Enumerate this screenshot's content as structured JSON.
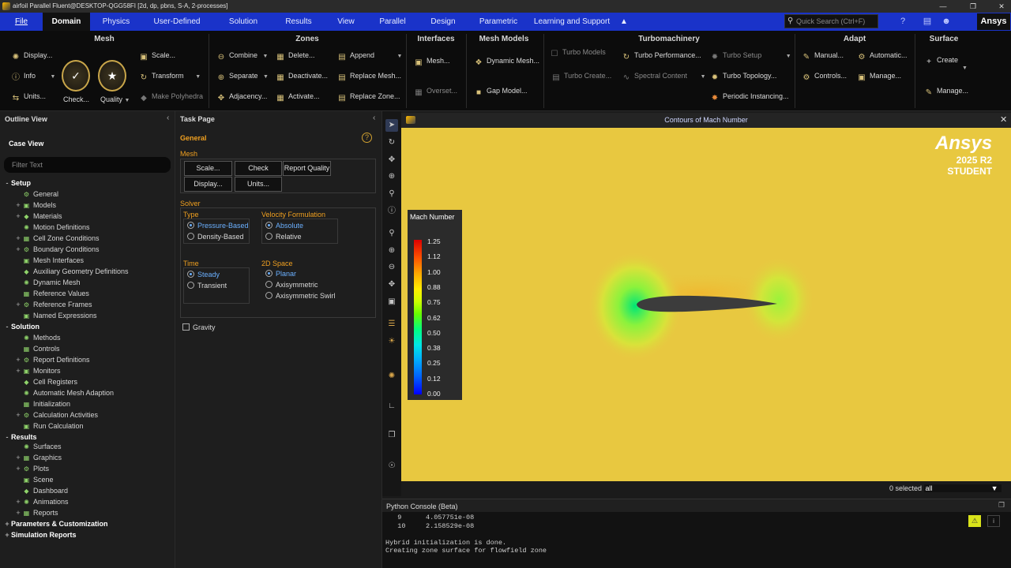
{
  "window": {
    "title": "airfoil Parallel Fluent@DESKTOP-QGG58FI  [2d, dp, pbns, S-A, 2-processes]"
  },
  "menu": {
    "items": [
      "File",
      "Domain",
      "Physics",
      "User-Defined",
      "Solution",
      "Results",
      "View",
      "Parallel",
      "Design",
      "Parametric",
      "Learning and Support"
    ],
    "active": "Domain",
    "search_placeholder": "Quick Search (Ctrl+F)",
    "brand": "Ansys"
  },
  "ribbon": {
    "mesh": {
      "title": "Mesh",
      "display": "Display...",
      "info": "Info",
      "units": "Units...",
      "check": "Check...",
      "quality": "Quality",
      "scale": "Scale...",
      "transform": "Transform",
      "make_polyhedra": "Make Polyhedra"
    },
    "zones": {
      "title": "Zones",
      "combine": "Combine",
      "separate": "Separate",
      "adjacency": "Adjacency...",
      "delete": "Delete...",
      "deactivate": "Deactivate...",
      "activate": "Activate...",
      "append": "Append",
      "replace_mesh": "Replace Mesh...",
      "replace_zone": "Replace Zone..."
    },
    "interfaces": {
      "title": "Interfaces",
      "mesh": "Mesh...",
      "overset": "Overset..."
    },
    "mesh_models": {
      "title": "Mesh Models",
      "dynamic_mesh": "Dynamic Mesh...",
      "gap_model": "Gap Model..."
    },
    "turbomachinery": {
      "title": "Turbomachinery",
      "turbo_models": "Turbo Models",
      "turbo_create": "Turbo Create...",
      "turbo_performance": "Turbo Performance...",
      "spectral_content": "Spectral Content",
      "turbo_setup": "Turbo Setup",
      "turbo_topology": "Turbo Topology...",
      "periodic_instancing": "Periodic Instancing..."
    },
    "adapt": {
      "title": "Adapt",
      "manual": "Manual...",
      "automatic": "Automatic...",
      "controls": "Controls...",
      "manage": "Manage..."
    },
    "surface": {
      "title": "Surface",
      "create": "Create",
      "manage": "Manage..."
    }
  },
  "outline": {
    "header": "Outline View",
    "case_view": "Case View",
    "filter_placeholder": "Filter Text",
    "tree": [
      {
        "label": "Setup",
        "level": 0,
        "section": true,
        "toggle": "-"
      },
      {
        "label": "General",
        "level": 1,
        "toggle": ""
      },
      {
        "label": "Models",
        "level": 1,
        "toggle": "+"
      },
      {
        "label": "Materials",
        "level": 1,
        "toggle": "+"
      },
      {
        "label": "Motion Definitions",
        "level": 1,
        "toggle": ""
      },
      {
        "label": "Cell Zone Conditions",
        "level": 1,
        "toggle": "+"
      },
      {
        "label": "Boundary Conditions",
        "level": 1,
        "toggle": "+"
      },
      {
        "label": "Mesh Interfaces",
        "level": 1,
        "toggle": ""
      },
      {
        "label": "Auxiliary Geometry Definitions",
        "level": 1,
        "toggle": ""
      },
      {
        "label": "Dynamic Mesh",
        "level": 1,
        "toggle": ""
      },
      {
        "label": "Reference Values",
        "level": 1,
        "toggle": ""
      },
      {
        "label": "Reference Frames",
        "level": 1,
        "toggle": "+"
      },
      {
        "label": "Named Expressions",
        "level": 1,
        "toggle": ""
      },
      {
        "label": "Solution",
        "level": 0,
        "section": true,
        "toggle": "-"
      },
      {
        "label": "Methods",
        "level": 1,
        "toggle": ""
      },
      {
        "label": "Controls",
        "level": 1,
        "toggle": ""
      },
      {
        "label": "Report Definitions",
        "level": 1,
        "toggle": "+"
      },
      {
        "label": "Monitors",
        "level": 1,
        "toggle": "+"
      },
      {
        "label": "Cell Registers",
        "level": 1,
        "toggle": ""
      },
      {
        "label": "Automatic Mesh Adaption",
        "level": 1,
        "toggle": ""
      },
      {
        "label": "Initialization",
        "level": 1,
        "toggle": ""
      },
      {
        "label": "Calculation Activities",
        "level": 1,
        "toggle": "+"
      },
      {
        "label": "Run Calculation",
        "level": 1,
        "toggle": ""
      },
      {
        "label": "Results",
        "level": 0,
        "section": true,
        "toggle": "-"
      },
      {
        "label": "Surfaces",
        "level": 1,
        "toggle": ""
      },
      {
        "label": "Graphics",
        "level": 1,
        "toggle": "+"
      },
      {
        "label": "Plots",
        "level": 1,
        "toggle": "+"
      },
      {
        "label": "Scene",
        "level": 1,
        "toggle": ""
      },
      {
        "label": "Dashboard",
        "level": 1,
        "toggle": ""
      },
      {
        "label": "Animations",
        "level": 1,
        "toggle": "+"
      },
      {
        "label": "Reports",
        "level": 1,
        "toggle": "+"
      },
      {
        "label": "Parameters & Customization",
        "level": 0,
        "section": true,
        "toggle": "+"
      },
      {
        "label": "Simulation Reports",
        "level": 0,
        "section": true,
        "toggle": "+"
      }
    ]
  },
  "task": {
    "header": "Task Page",
    "title": "General",
    "mesh_label": "Mesh",
    "scale": "Scale...",
    "check": "Check",
    "report_quality": "Report Quality",
    "display": "Display...",
    "units": "Units...",
    "solver_label": "Solver",
    "type_label": "Type",
    "pressure_based": "Pressure-Based",
    "density_based": "Density-Based",
    "velocity_label": "Velocity Formulation",
    "absolute": "Absolute",
    "relative": "Relative",
    "time_label": "Time",
    "steady": "Steady",
    "transient": "Transient",
    "space_label": "2D Space",
    "planar": "Planar",
    "axisymmetric": "Axisymmetric",
    "axisymmetric_swirl": "Axisymmetric Swirl",
    "gravity": "Gravity"
  },
  "graphics": {
    "title": "Contours of Mach Number",
    "brand_line1": "Ansys",
    "brand_line2": "2025 R2",
    "brand_line3": "STUDENT",
    "legend_title": "Mach Number",
    "legend_values": [
      "1.25",
      "1.12",
      "1.00",
      "0.88",
      "0.75",
      "0.62",
      "0.50",
      "0.38",
      "0.25",
      "0.12",
      "0.00"
    ],
    "selection_count": "0 selected",
    "selection_filter": "all"
  },
  "console": {
    "title": "Python Console (Beta)",
    "lines": [
      "   9      4.057751e-08",
      "   10     2.158529e-08",
      "",
      "Hybrid initialization is done.",
      "Creating zone surface for flowfield zone"
    ]
  },
  "colors": {
    "menubar": "#1a33c9",
    "accent": "#f0a020",
    "field": "#e8c840"
  }
}
